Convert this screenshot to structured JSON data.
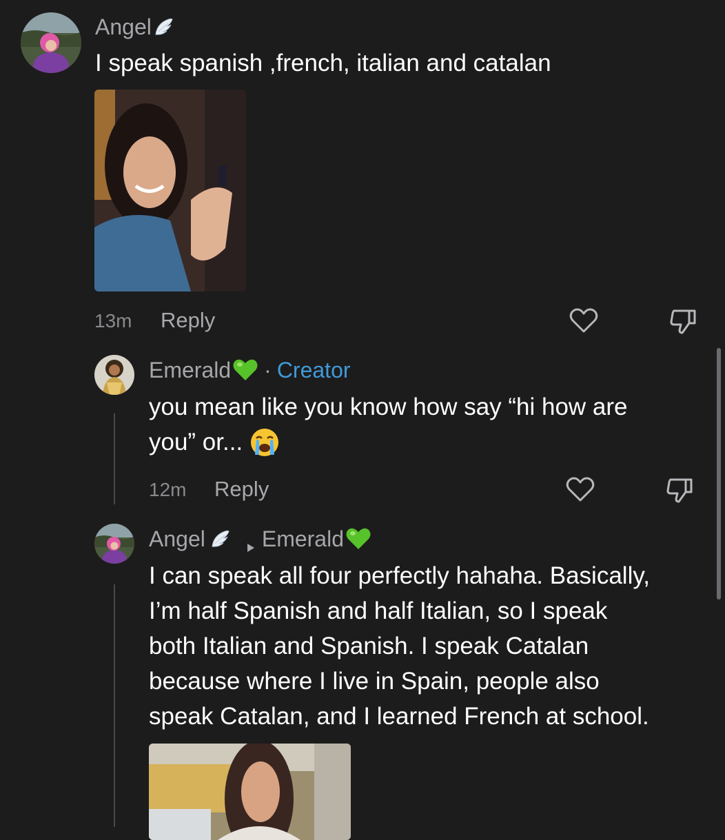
{
  "comments": [
    {
      "username": "Angel",
      "text": "I speak spanish ,french, italian and catalan",
      "time": "13m",
      "reply_label": "Reply"
    },
    {
      "username": "Emerald",
      "badge_separator": "·",
      "badge": "Creator",
      "text_line1": "you mean like you know how say “hi how are",
      "text_line2": "you” or...",
      "time": "12m",
      "reply_label": "Reply"
    },
    {
      "username": "Angel",
      "reply_to": "Emerald",
      "text_lines": [
        "I can speak all four perfectly hahaha. Basically,",
        "I’m half Spanish and half Italian, so I speak",
        "both Italian and Spanish. I speak Catalan",
        "because where I live in Spain, people also",
        "speak Catalan, and I learned French at school."
      ]
    }
  ],
  "colors": {
    "background": "#1c1c1c",
    "username": "#a6a6ab",
    "creator_badge": "#3f9ad8",
    "text": "#ffffff",
    "meta": "#8a8a8e"
  },
  "icons": {
    "wing": "wing-icon",
    "green_heart": "green-heart-emoji",
    "crying": "crying-face-emoji",
    "like": "heart-outline-icon",
    "dislike": "thumbs-down-icon",
    "reply_arrow": "triangle-right-icon"
  }
}
